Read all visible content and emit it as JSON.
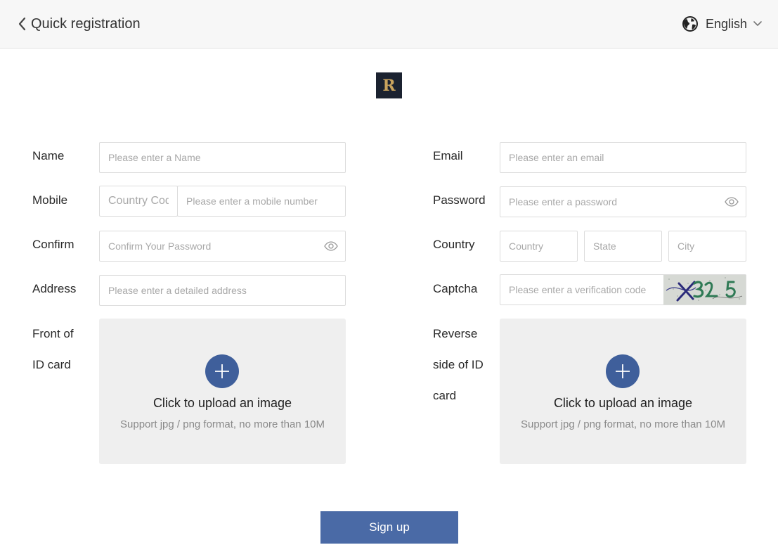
{
  "header": {
    "back_icon": "chevron-left-icon",
    "title": "Quick registration",
    "language": {
      "icon": "globe-icon",
      "label": "English",
      "chevron": "chevron-down-icon"
    }
  },
  "logo": {
    "letter": "R",
    "bg_color": "#1b2230",
    "fg_color": "#c9a35d"
  },
  "form": {
    "name": {
      "label": "Name",
      "placeholder": "Please enter a Name"
    },
    "email": {
      "label": "Email",
      "placeholder": "Please enter an email"
    },
    "mobile": {
      "label": "Mobile",
      "country_code_placeholder": "Country Code",
      "placeholder": "Please enter a mobile number"
    },
    "password": {
      "label": "Password",
      "placeholder": "Please enter a password",
      "icon": "eye-icon"
    },
    "confirm": {
      "label": "Confirm",
      "placeholder": "Confirm Your Password",
      "icon": "eye-icon"
    },
    "country": {
      "label": "Country",
      "country_placeholder": "Country",
      "state_placeholder": "State",
      "city_placeholder": "City"
    },
    "address": {
      "label": "Address",
      "placeholder": "Please enter a detailed address"
    },
    "captcha": {
      "label": "Captcha",
      "placeholder": "Please enter a verification code"
    },
    "id_front": {
      "label_line1": "Front of",
      "label_line2": "ID card",
      "upload_title": "Click to upload an image",
      "upload_hint": "Support jpg / png format, no more than 10M",
      "icon": "plus-icon"
    },
    "id_back": {
      "label_line1": "Reverse",
      "label_line2": "side of ID",
      "label_line3": "card",
      "upload_title": "Click to upload an image",
      "upload_hint": "Support jpg / png format, no more than 10M",
      "icon": "plus-icon"
    }
  },
  "submit": {
    "label": "Sign up"
  },
  "colors": {
    "accent": "#4a6aa6",
    "upload_icon_bg": "#3f5f9b",
    "upload_bg": "#efefef"
  }
}
